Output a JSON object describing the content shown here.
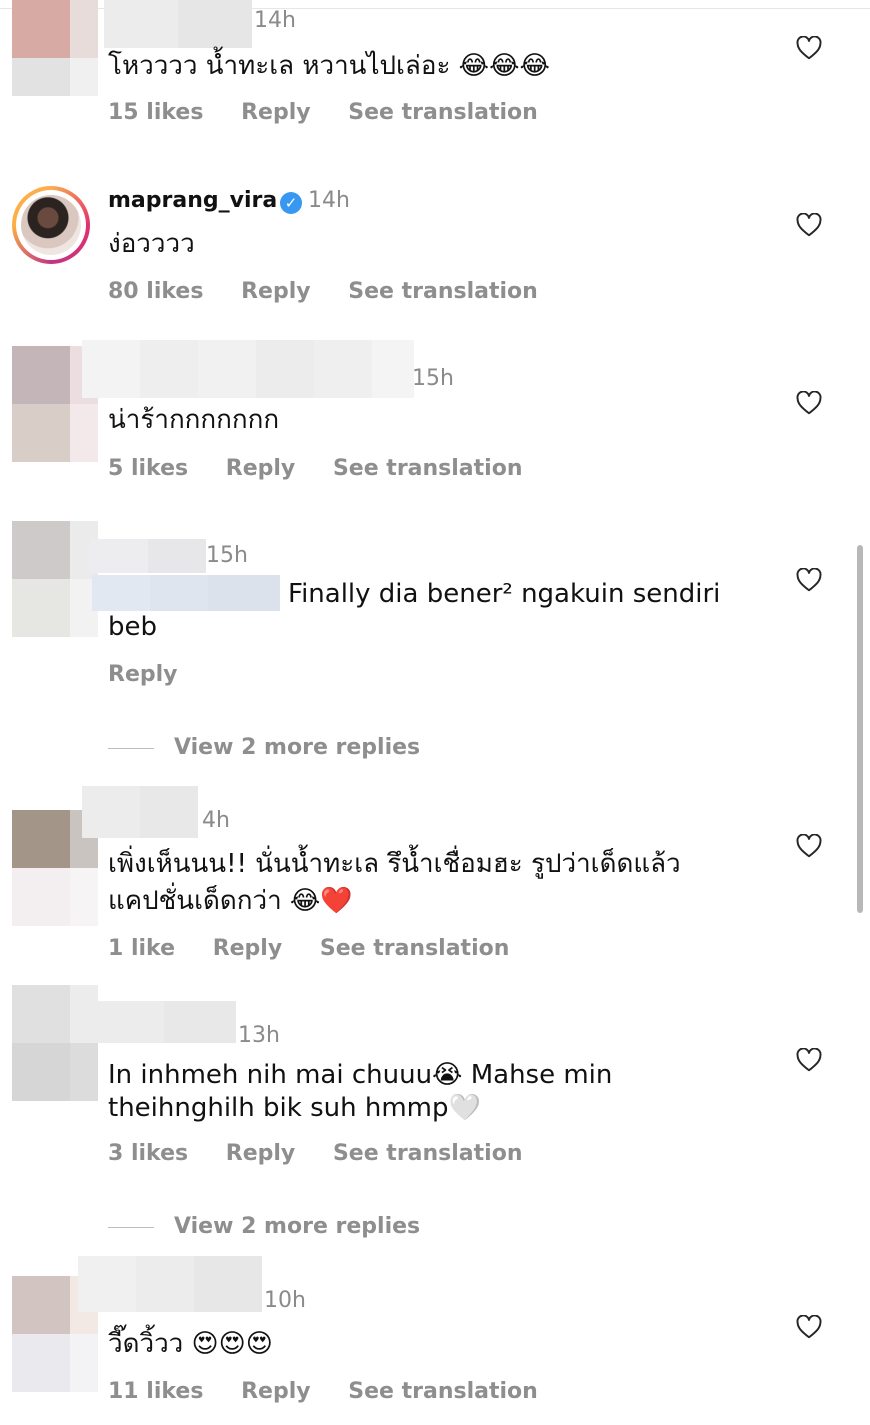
{
  "comments": [
    {
      "time": "14h",
      "text": "โหวววว น้ำทะเล หวานไปเล่อะ 😂😂😂",
      "likes": "15 likes",
      "reply": "Reply",
      "translate": "See translation"
    },
    {
      "username": "maprang_vira",
      "verified_mark": "✓",
      "time": "14h",
      "text": "ง่อวววว",
      "likes": "80 likes",
      "reply": "Reply",
      "translate": "See translation"
    },
    {
      "time": "15h",
      "text": "น่าร้ากกกกกกก",
      "likes": "5 likes",
      "reply": "Reply",
      "translate": "See translation"
    },
    {
      "time": "15h",
      "text_line1": "Finally dia bener² ngakuin sendiri",
      "text_line2": "beb",
      "reply": "Reply",
      "view_more": "View 2 more replies"
    },
    {
      "time": "4h",
      "text_line1": "เพิ่งเห็นนน!! นั่นน้ำทะเล รึน้ำเชื่อมฮะ รูปว่าเด็ดแล้ว",
      "text_line2": "แคปชั่นเด็ดกว่า 😂❤️",
      "likes": "1 like",
      "reply": "Reply",
      "translate": "See translation"
    },
    {
      "time": "13h",
      "text_line1": "In inhmeh nih mai chuuu😭 Mahse min",
      "text_line2": "theihnghilh bik suh hmmp🤍",
      "likes": "3 likes",
      "reply": "Reply",
      "translate": "See translation",
      "view_more": "View 2 more replies"
    },
    {
      "time": "10h",
      "text": "วี๊ดวิ้วว 😍😍😍",
      "likes": "11 likes",
      "reply": "Reply",
      "translate": "See translation"
    }
  ],
  "icons": {
    "like": "heart-outline-icon"
  },
  "colors": {
    "muted": "#8e8e8e",
    "verified": "#3897f0"
  }
}
